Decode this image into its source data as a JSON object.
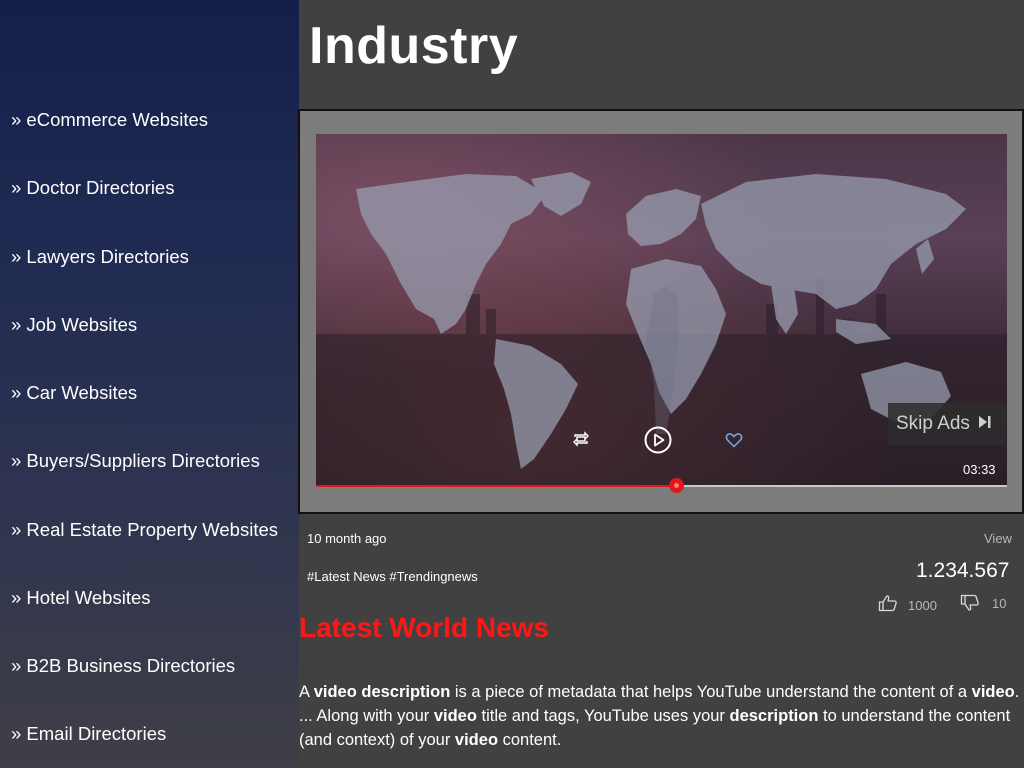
{
  "sidebar": {
    "items": [
      {
        "label": "» eCommerce Websites"
      },
      {
        "label": "» Doctor Directories"
      },
      {
        "label": "» Lawyers Directories"
      },
      {
        "label": "» Job Websites"
      },
      {
        "label": "» Car Websites"
      },
      {
        "label": "» Buyers/Suppliers Directories"
      },
      {
        "label": "» Real Estate Property Websites"
      },
      {
        "label": "» Hotel Websites"
      },
      {
        "label": "» B2B Business Directories"
      },
      {
        "label": "» Email Directories"
      }
    ]
  },
  "header": {
    "title": "Industry"
  },
  "player": {
    "skip_ads_label": "Skip Ads",
    "duration": "03:33",
    "progress_fraction": 0.522,
    "controls": {
      "repeat_icon": "repeat-icon",
      "play_icon": "play-circle-icon",
      "like_icon": "heart-icon",
      "skip_icon": "skip-next-icon"
    },
    "accent_color": "#e3161c"
  },
  "meta": {
    "posted": "10 month ago",
    "hashtags": "#Latest News #Trendingnews",
    "view_label": "View",
    "view_count": "1.234.567",
    "likes": "1000",
    "dislikes": "10"
  },
  "article": {
    "title": "Latest World News",
    "title_color": "#ff1717",
    "description_parts": {
      "p1": "A ",
      "b1": "video description",
      "p2": " is a piece of metadata that helps YouTube understand the content of a ",
      "b2": "video",
      "p3": ". ... Along with your ",
      "b3": "video",
      "p4": " title and tags, YouTube uses your ",
      "b4": "description",
      "p5": " to understand the content (and context) of your ",
      "b5": "video",
      "p6": " content."
    }
  }
}
